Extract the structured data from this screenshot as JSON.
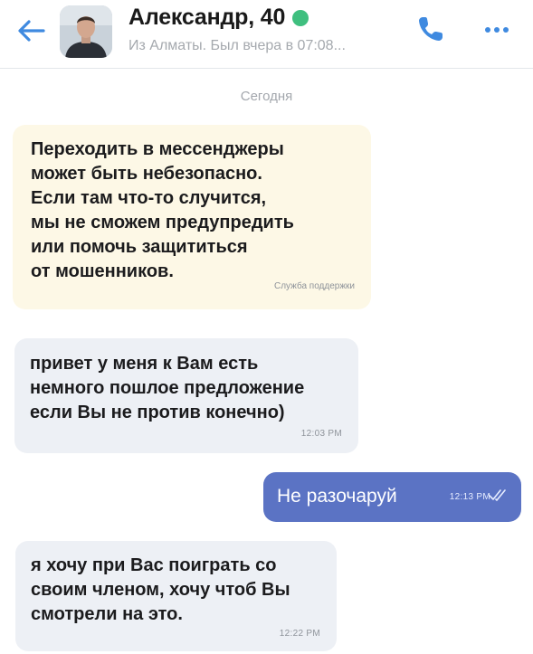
{
  "header": {
    "back_icon": "arrow-left-icon",
    "name": "Александр, 40",
    "online_color": "#3fbf7f",
    "status": "Из Алматы. Был вчера в 07:08...",
    "call_icon": "phone-icon",
    "more_icon": "more-dots-icon"
  },
  "chat": {
    "date_separator": "Сегодня",
    "notice": {
      "text": "Переходить в мессенджеры\nможет быть небезопасно.\nЕсли там что-то случится,\nмы не сможем предупредить\nили помочь защититься\nот мошенников.",
      "signature": "Служба поддержки"
    },
    "messages": [
      {
        "direction": "incoming",
        "text": "привет у меня к Вам есть\nнемного пошлое предложение\nесли Вы не против конечно)",
        "time": "12:03 PM"
      },
      {
        "direction": "outgoing",
        "text": "Не разочаруй",
        "time": "12:13 PM",
        "status_icon": "read-check-icon"
      },
      {
        "direction": "incoming",
        "text": "я хочу при Вас поиграть со\nсвоим членом, хочу чтоб Вы\nсмотрели на это.",
        "time": "12:22 PM"
      }
    ]
  },
  "colors": {
    "accent": "#3f8ae0",
    "outgoing_bubble": "#5b73c4",
    "incoming_bubble": "#edf0f5",
    "notice_bubble": "#fdf8e6"
  }
}
